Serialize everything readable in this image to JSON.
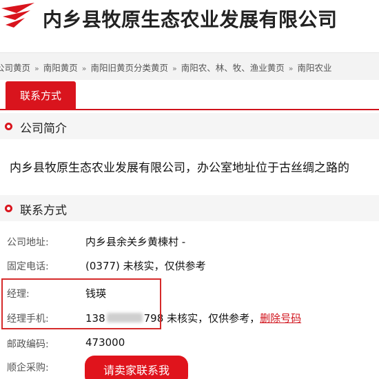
{
  "header": {
    "company_name": "内乡县牧原生态农业发展有限公司"
  },
  "breadcrumb": {
    "items": [
      "公司黄页",
      "南阳黄页",
      "南阳旧黄页分类黄页",
      "南阳农、林、牧、渔业黄页",
      "南阳农业"
    ],
    "separator": "»"
  },
  "tabs": {
    "contact_tab_label": "联系方式"
  },
  "company_intro": {
    "heading": "公司简介",
    "text": "内乡县牧原生态农业发展有限公司，办公室地址位于古丝绸之路的"
  },
  "contact": {
    "heading": "联系方式",
    "rows": [
      {
        "label": "公司地址:",
        "value": "内乡县余关乡黄楝村 -"
      },
      {
        "label": "固定电话:",
        "value": "(0377) 未核实，仅供参考"
      },
      {
        "label": "经理:",
        "value": "钱瑛"
      },
      {
        "label": "经理手机:",
        "value_prefix": "138",
        "value_suffix": "798",
        "value_note": "未核实，仅供参考，",
        "delete_link": "删除号码"
      },
      {
        "label": "邮政编码:",
        "value": "473000"
      },
      {
        "label": "顺企采购:"
      }
    ],
    "contact_seller_button": "请卖家联系我"
  },
  "colors": {
    "brand_red": "#d9141d",
    "highlight_border": "#d52a2a"
  }
}
